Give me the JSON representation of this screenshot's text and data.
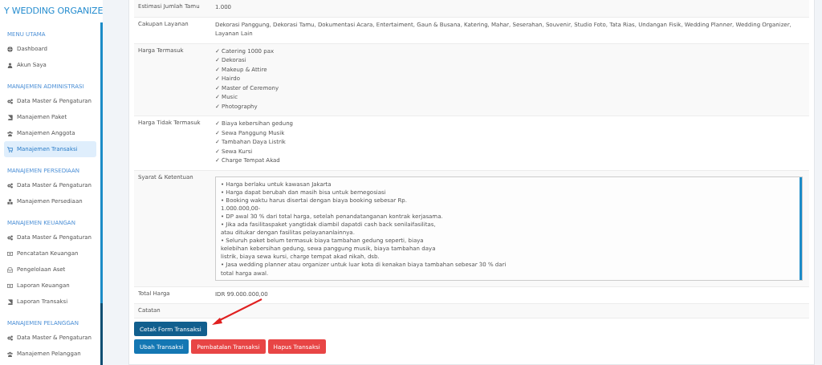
{
  "sidebar": {
    "brand": "Y WEDDING ORGANIZE",
    "sections": [
      {
        "title": "MENU UTAMA",
        "items": [
          {
            "label": "Dashboard",
            "kind": "globe",
            "selected": false
          },
          {
            "label": "Akun Saya",
            "kind": "user",
            "selected": false
          }
        ]
      },
      {
        "title": "MANAJEMEN ADMINISTRASI",
        "items": [
          {
            "label": "Data Master & Pengaturan",
            "kind": "gears",
            "selected": false
          },
          {
            "label": "Manajemen Paket",
            "kind": "book",
            "selected": false
          },
          {
            "label": "Manajemen Anggota",
            "kind": "users",
            "selected": false
          },
          {
            "label": "Manajemen Transaksi",
            "kind": "cart",
            "selected": true
          }
        ]
      },
      {
        "title": "MANAJEMEN PERSEDIAAN",
        "items": [
          {
            "label": "Data Master & Pengaturan",
            "kind": "gears",
            "selected": false
          },
          {
            "label": "Manajemen Persediaan",
            "kind": "cubes",
            "selected": false
          }
        ]
      },
      {
        "title": "MANAJEMEN KEUANGAN",
        "items": [
          {
            "label": "Data Master & Pengaturan",
            "kind": "gears",
            "selected": false
          },
          {
            "label": "Pencatatan Keuangan",
            "kind": "money",
            "selected": false
          },
          {
            "label": "Pengelolaan Aset",
            "kind": "inbox",
            "selected": false
          },
          {
            "label": "Laporan Keuangan",
            "kind": "money",
            "selected": false
          },
          {
            "label": "Laporan Transaksi",
            "kind": "book",
            "selected": false
          }
        ]
      },
      {
        "title": "MANAJEMEN PELANGGAN",
        "items": [
          {
            "label": "Data Master & Pengaturan",
            "kind": "gears",
            "selected": false
          },
          {
            "label": "Manajemen Pelanggan",
            "kind": "users",
            "selected": false
          }
        ]
      }
    ]
  },
  "details": [
    {
      "label": "Estimasi Jumlah Tamu",
      "kind": "text",
      "value": "1.000"
    },
    {
      "label": "Cakupan Layanan",
      "kind": "text",
      "value": "Dekorasi Panggung, Dekorasi Tamu, Dokumentasi Acara, Entertaiment, Gaun & Busana, Katering, Mahar, Seserahan, Souvenir, Studio Foto, Tata Rias, Undangan Fisik, Wedding Planner, Wedding Organizer, Layanan Lain"
    },
    {
      "label": "Harga Termasuk",
      "kind": "list",
      "items": [
        "✓ Catering 1000 pax",
        "✓ Dekorasi",
        "✓ Makeup & Attire",
        "✓ Hairdo",
        "✓ Master of Ceremony",
        "✓ Music",
        "✓ Photography"
      ]
    },
    {
      "label": "Harga Tidak Termasuk",
      "kind": "list",
      "items": [
        "✓ Biaya kebersihan gedung",
        "✓ Sewa Panggung Musik",
        "✓ Tambahan Daya Listrik",
        "✓ Sewa Kursi",
        "✓ Charge Tempat Akad"
      ]
    },
    {
      "label": "Syarat & Ketentuan",
      "kind": "textarea",
      "lines": [
        "• Harga berlaku untuk kawasan Jakarta",
        "• Harga dapat berubah dan masih bisa untuk bernegosiasi",
        "• Booking waktu harus disertai dengan biaya booking sebesar Rp.",
        "1.000.000,00-",
        "• DP awal 30 % dari total harga, setelah penandatanganan kontrak kerjasama.",
        "• Jika ada fasilitaspaket yangtidak diambil dapatdi cash back senilaifasilitas,",
        "atau ditukar dengan fasilitas pelayananlainnya.",
        "• Seluruh paket belum termasuk biaya tambahan gedung seperti, biaya",
        "kelebihan kebersihan gedung, sewa panggung musik, biaya tambahan daya",
        "listrik, biaya sewa kursi, charge tempat akad nikah, dsb.",
        "• Jasa wedding planner atau organizer untuk luar kota di kenakan biaya tambahan sebesar 30 % dari",
        "total harga awal."
      ]
    },
    {
      "label": "Total Harga",
      "kind": "text",
      "value": "IDR 99.000.000,00"
    },
    {
      "label": "Catatan",
      "kind": "text"
    }
  ],
  "button_rows": [
    [
      {
        "label": "Cetak Form Transaksi",
        "kind": "primary"
      }
    ],
    [
      {
        "label": "Ubah Transaksi",
        "kind": "primary"
      },
      {
        "label": "Pembatalan Transaksi",
        "kind": "danger"
      },
      {
        "label": "Hapus Transaksi",
        "kind": "danger"
      }
    ]
  ]
}
